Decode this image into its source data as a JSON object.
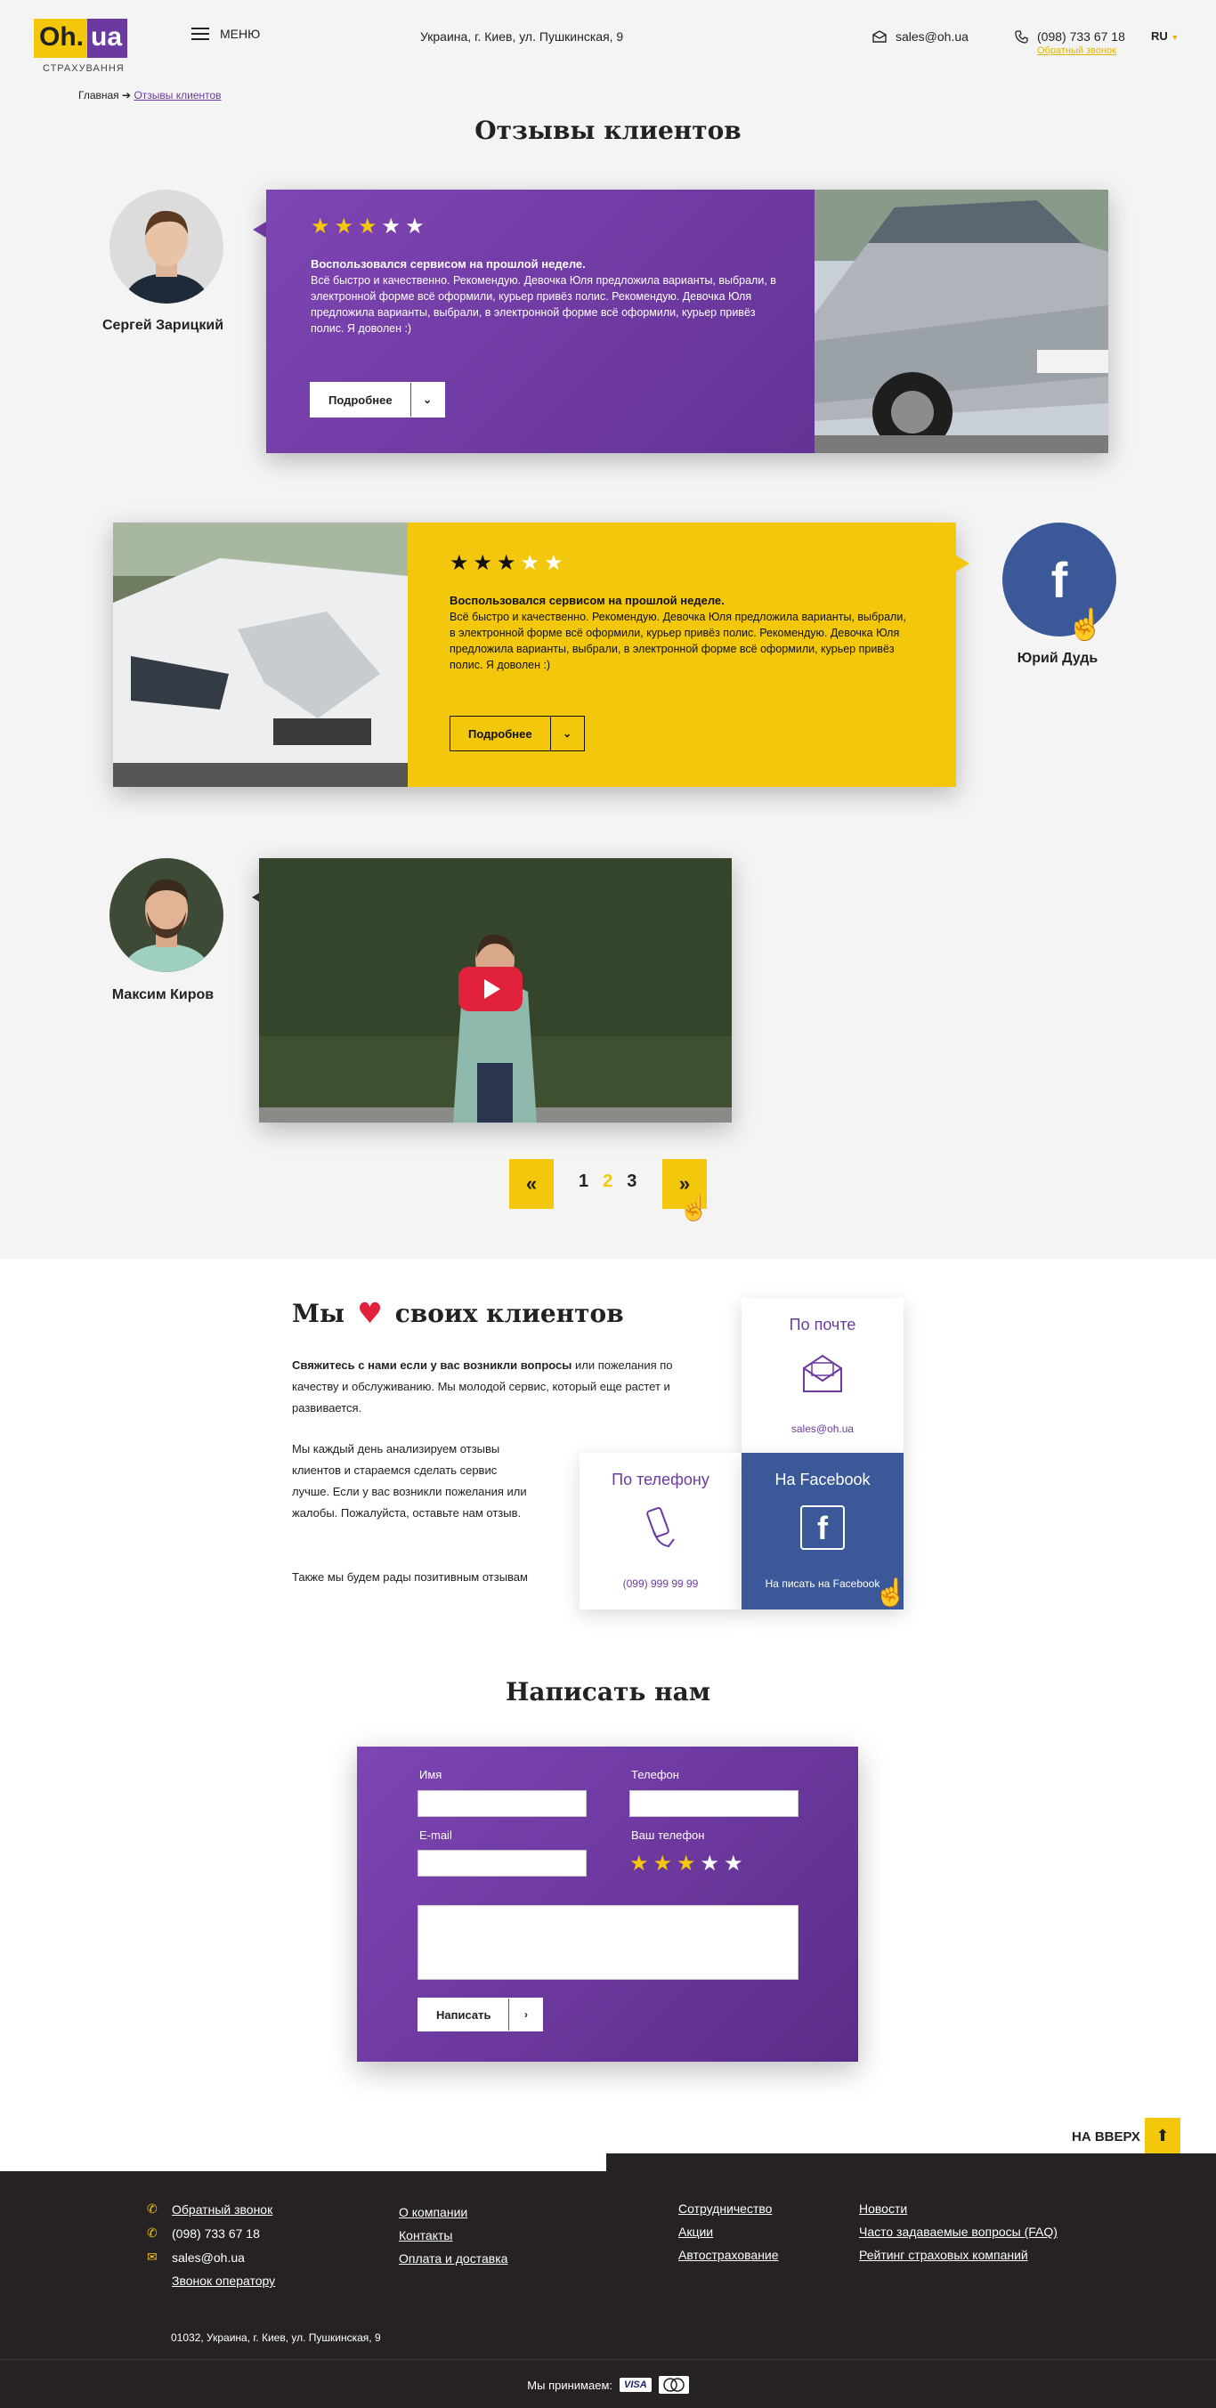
{
  "header": {
    "logo_oh": "Oh.",
    "logo_ua": "ua",
    "logo_sub": "СТРАХУВАННЯ",
    "menu_label": "МЕНЮ",
    "address": "Украина, г. Киев, ул. Пушкинская, 9",
    "email": "sales@oh.ua",
    "phone": "(098) 733 67 18",
    "callback": "Обратный звонок",
    "lang": "RU"
  },
  "breadcrumb": {
    "home": "Главная",
    "current": "Отзывы клиентов"
  },
  "page_title": "Отзывы клиентов",
  "reviews": [
    {
      "author": "Сергей Зарицкий",
      "rating": 3,
      "headline": "Воспользовался сервисом на прошлой неделе.",
      "body": "Всё быстро и качественно. Рекомендую. Девочка Юля предложила варианты, выбрали, в электронной форме всё оформили, курьер привёз полис. Рекомендую. Девочка Юля предложила варианты, выбрали, в электронной форме всё оформили, курьер привёз полис. Я доволен :)",
      "button": "Подробнее"
    },
    {
      "author": "Юрий Дудь",
      "rating": 3,
      "headline": "Воспользовался сервисом на прошлой неделе.",
      "body": "Всё быстро и качественно. Рекомендую. Девочка Юля предложила варианты, выбрали, в электронной форме всё оформили, курьер привёз полис. Рекомендую. Девочка Юля предложила варианты, выбрали, в электронной форме всё оформили, курьер привёз полис. Я доволен :)",
      "button": "Подробнее"
    },
    {
      "author": "Максим Киров"
    }
  ],
  "pagination": {
    "prev": "«",
    "next": "»",
    "pages": [
      "1",
      "2",
      "3"
    ],
    "current": "2"
  },
  "love": {
    "title_start": "Мы",
    "title_end": "своих клиентов",
    "p1_bold": "Свяжитесь с нами если у вас возникли вопросы",
    "p1_rest": " или пожелания по качеству и обслуживанию. Мы молодой сервис, который еще растет и развивается.",
    "p2": "Мы каждый день анализируем отзывы клиентов и стараемся сделать сервис лучше. Если у вас возникли пожелания или жалобы. Пожалуйста, оставьте нам отзыв.",
    "p3": "Также мы будем рады позитивным отзывам",
    "mail_title": "По почте",
    "mail_value": "sales@oh.ua",
    "phone_title": "По телефону",
    "phone_value": "(099) 999 99 99",
    "fb_title": "На Facebook",
    "fb_value": "На писать на Facebook"
  },
  "form": {
    "title": "Написать нам",
    "name_label": "Имя",
    "phone_label": "Телефон",
    "email_label": "E-mail",
    "rating_label": "Ваш телефон",
    "rating": 3,
    "submit": "Написать"
  },
  "to_top": "НА ВВЕРХ",
  "footer": {
    "callback": "Обратный звонок",
    "phone": "(098) 733 67 18",
    "email": "sales@oh.ua",
    "operator": "Звонок оператору",
    "col2": [
      "О компании",
      "Контакты",
      "Оплата и доставка"
    ],
    "col3": [
      "Сотрудничество",
      "Акции",
      "Автострахование"
    ],
    "col4": [
      "Новости",
      "Часто задаваемые вопросы (FAQ)",
      "Рейтинг страховых компаний"
    ],
    "address": "01032, Украина, г. Киев, ул. Пушкинская, 9",
    "accept": "Мы принимаем:",
    "visa": "VISA"
  },
  "colors": {
    "purple": "#6b3aa0",
    "yellow": "#f2c70c",
    "facebook": "#3b5998",
    "footer": "#262224"
  }
}
